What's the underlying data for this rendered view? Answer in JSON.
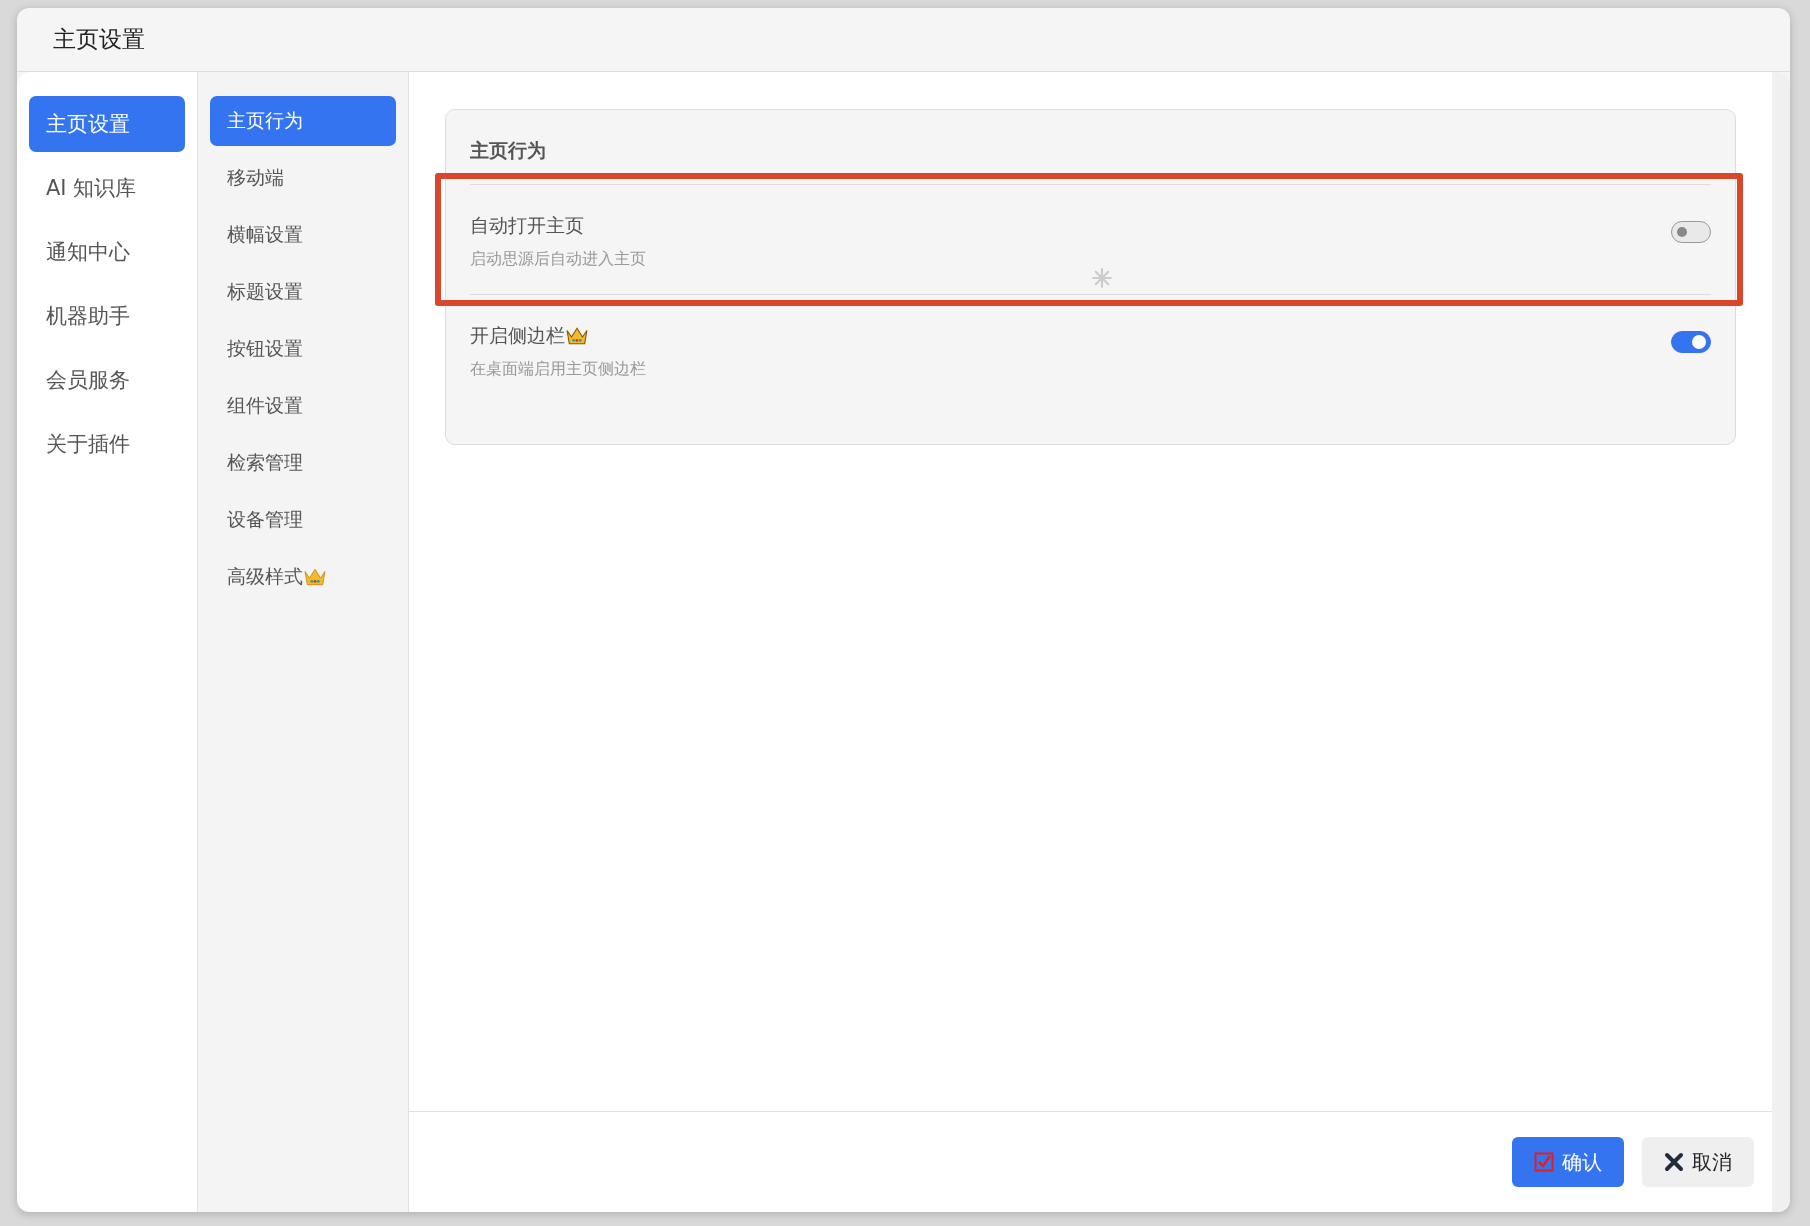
{
  "dialog": {
    "title": "主页设置"
  },
  "main_nav": [
    {
      "label": "主页设置",
      "selected": true
    },
    {
      "label": "AI 知识库",
      "selected": false
    },
    {
      "label": "通知中心",
      "selected": false
    },
    {
      "label": "机器助手",
      "selected": false
    },
    {
      "label": "会员服务",
      "selected": false
    },
    {
      "label": "关于插件",
      "selected": false
    }
  ],
  "sub_nav": [
    {
      "label": "主页行为",
      "selected": true,
      "crown": false
    },
    {
      "label": "移动端",
      "selected": false,
      "crown": false
    },
    {
      "label": "横幅设置",
      "selected": false,
      "crown": false
    },
    {
      "label": "标题设置",
      "selected": false,
      "crown": false
    },
    {
      "label": "按钮设置",
      "selected": false,
      "crown": false
    },
    {
      "label": "组件设置",
      "selected": false,
      "crown": false
    },
    {
      "label": "检索管理",
      "selected": false,
      "crown": false
    },
    {
      "label": "设备管理",
      "selected": false,
      "crown": false
    },
    {
      "label": "高级样式",
      "selected": false,
      "crown": true
    }
  ],
  "section": {
    "title": "主页行为",
    "settings": [
      {
        "label": "自动打开主页",
        "description": "启动思源后自动进入主页",
        "on": false,
        "crown": false,
        "highlighted": true
      },
      {
        "label": "开启侧边栏",
        "description": "在桌面端启用主页侧边栏",
        "on": true,
        "crown": true,
        "highlighted": false
      }
    ]
  },
  "buttons": [
    {
      "label": "确认",
      "kind": "confirm"
    },
    {
      "label": "取消",
      "kind": "cancel"
    }
  ]
}
